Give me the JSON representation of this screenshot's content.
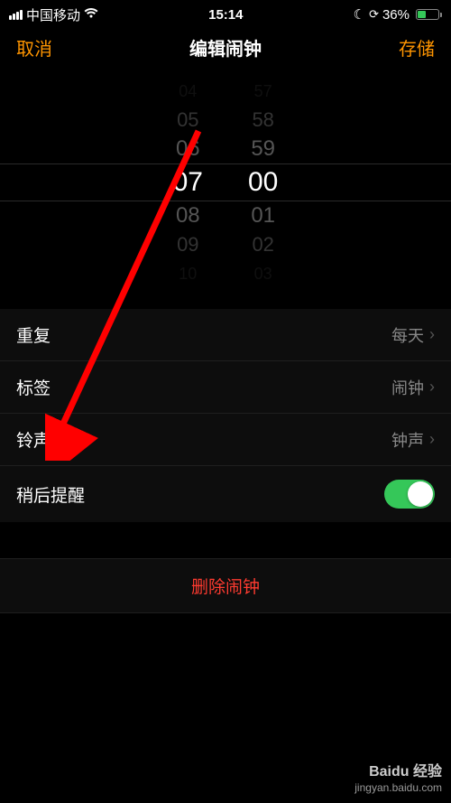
{
  "status": {
    "carrier": "中国移动",
    "time": "15:14",
    "battery_pct": "36%"
  },
  "nav": {
    "cancel": "取消",
    "title": "编辑闹钟",
    "save": "存储"
  },
  "picker": {
    "hour_selected": "07",
    "minute_selected": "00",
    "hours": [
      "04",
      "05",
      "06",
      "07",
      "08",
      "09",
      "10"
    ],
    "minutes": [
      "57",
      "58",
      "59",
      "00",
      "01",
      "02",
      "03"
    ]
  },
  "settings": {
    "repeat": {
      "label": "重复",
      "value": "每天"
    },
    "label": {
      "label": "标签",
      "value": "闹钟"
    },
    "sound": {
      "label": "铃声",
      "value": "钟声"
    },
    "snooze": {
      "label": "稍后提醒",
      "on": true
    }
  },
  "delete": {
    "label": "删除闹钟"
  },
  "watermark": {
    "brand": "Baidu 经验",
    "url": "jingyan.baidu.com"
  }
}
